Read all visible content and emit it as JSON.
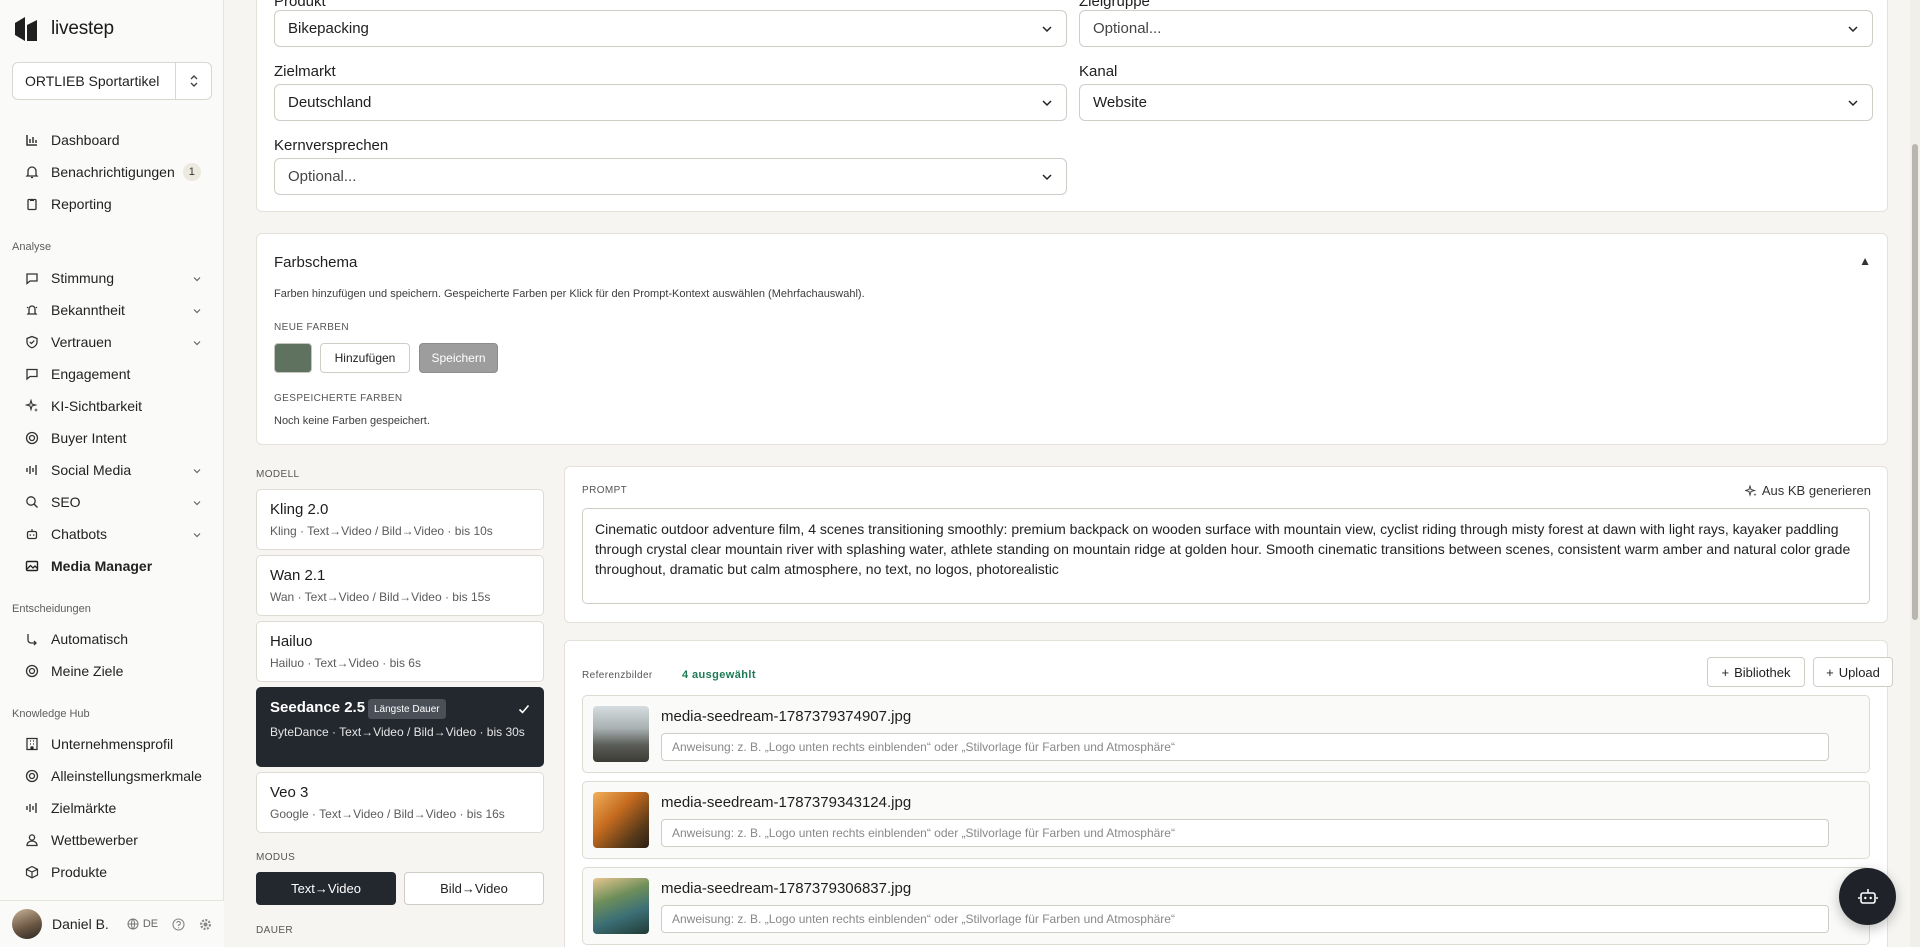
{
  "sidebar": {
    "logo_text": "livestep",
    "org": "ORTLIEB Sportartikel",
    "nav_top": [
      {
        "label": "Dashboard",
        "icon": "bar-chart-icon"
      },
      {
        "label": "Benachrichtigungen",
        "icon": "bell-icon",
        "badge": "1"
      },
      {
        "label": "Reporting",
        "icon": "clipboard-icon"
      }
    ],
    "section_analyse": "Analyse",
    "nav_analyse": [
      {
        "label": "Stimmung",
        "icon": "message-icon",
        "chevron": true
      },
      {
        "label": "Bekanntheit",
        "icon": "bell-ring-icon",
        "chevron": true
      },
      {
        "label": "Vertrauen",
        "icon": "shield-check-icon",
        "chevron": true
      },
      {
        "label": "Engagement",
        "icon": "message-square-icon"
      },
      {
        "label": "KI-Sichtbarkeit",
        "icon": "sparkles-icon"
      },
      {
        "label": "Buyer Intent",
        "icon": "target-icon"
      },
      {
        "label": "Social Media",
        "icon": "audio-lines-icon",
        "chevron": true
      },
      {
        "label": "SEO",
        "icon": "search-icon",
        "chevron": true
      },
      {
        "label": "Chatbots",
        "icon": "bot-icon",
        "chevron": true
      },
      {
        "label": "Media Manager",
        "icon": "image-icon",
        "active": true
      }
    ],
    "section_entscheidungen": "Entscheidungen",
    "nav_entscheidungen": [
      {
        "label": "Automatisch",
        "icon": "workflow-icon"
      },
      {
        "label": "Meine Ziele",
        "icon": "target-icon"
      }
    ],
    "section_knowledge": "Knowledge Hub",
    "nav_knowledge": [
      {
        "label": "Unternehmensprofil",
        "icon": "building-icon"
      },
      {
        "label": "Alleinstellungsmerkmale",
        "icon": "target-icon"
      },
      {
        "label": "Zielmärkte",
        "icon": "audio-lines-icon"
      },
      {
        "label": "Wettbewerber",
        "icon": "user-icon"
      },
      {
        "label": "Produkte",
        "icon": "package-icon"
      }
    ],
    "user": {
      "name": "Daniel B.",
      "lang": "DE"
    }
  },
  "form": {
    "produkt_label": "Produkt",
    "produkt_value": "Bikepacking",
    "zielgruppe_label": "Zielgruppe",
    "zielgruppe_value": "Optional...",
    "zielmarkt_label": "Zielmarkt",
    "zielmarkt_value": "Deutschland",
    "kanal_label": "Kanal",
    "kanal_value": "Website",
    "kernversprechen_label": "Kernversprechen",
    "kernversprechen_value": "Optional..."
  },
  "farbschema": {
    "title": "Farbschema",
    "toggle": "▲",
    "description": "Farben hinzufügen und speichern. Gespeicherte Farben per Klick für den Prompt-Kontext auswählen (Mehrfachauswahl).",
    "neue_label": "Neue Farben",
    "swatch_color": "#5f7260",
    "add_label": "Hinzufügen",
    "save_label": "Speichern",
    "saved_label": "Gespeicherte Farben",
    "empty_text": "Noch keine Farben gespeichert."
  },
  "modell": {
    "label": "Modell",
    "models": [
      {
        "name": "Kling 2.0",
        "desc": "Kling · Text→Video / Bild→Video · bis 10s"
      },
      {
        "name": "Wan 2.1",
        "desc": "Wan · Text→Video / Bild→Video · bis 15s"
      },
      {
        "name": "Hailuo",
        "desc": "Hailuo · Text→Video · bis 6s"
      },
      {
        "name": "Seedance 2.5",
        "desc": "ByteDance · Text→Video / Bild→Video · bis 30s",
        "tag": "Längste Dauer",
        "selected": true
      },
      {
        "name": "Veo 3",
        "desc": "Google · Text→Video / Bild→Video · bis 16s"
      }
    ],
    "modus_label": "Modus",
    "modus_on": "Text→Video",
    "modus_off": "Bild→Video",
    "dauer_label": "Dauer"
  },
  "prompt": {
    "label": "Prompt",
    "generate_label": "Aus KB generieren",
    "text": "Cinematic outdoor adventure film, 4 scenes transitioning smoothly: premium backpack on wooden surface with mountain view, cyclist riding through misty forest at dawn with light rays, kayaker paddling through crystal clear mountain river with splashing water, athlete standing on mountain ridge at golden hour. Smooth cinematic transitions between scenes, consistent warm amber and natural color grade throughout, dramatic but calm atmosphere, no text, no logos, photorealistic"
  },
  "referenz": {
    "label": "Referenzbilder",
    "count": "4 ausgewählt",
    "bibliothek": "Bibliothek",
    "upload": "Upload",
    "placeholder": "Anweisung: z. B. „Logo unten rechts einblenden“ oder „Stilvorlage für Farben und Atmosphäre“",
    "items": [
      {
        "name": "media-seedream-1787379374907.jpg"
      },
      {
        "name": "media-seedream-1787379343124.jpg"
      },
      {
        "name": "media-seedream-1787379306837.jpg"
      }
    ]
  }
}
